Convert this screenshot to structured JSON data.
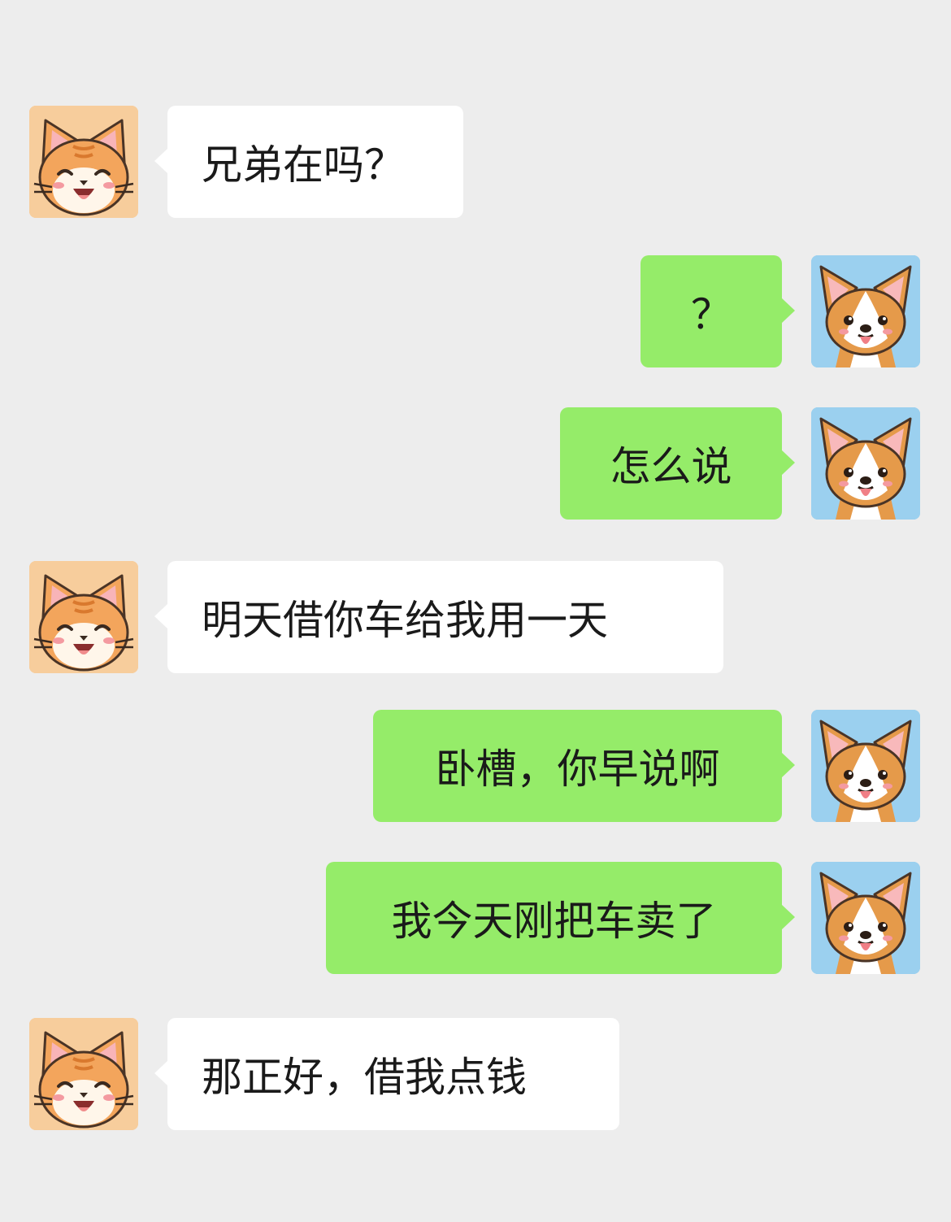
{
  "chat": {
    "messages": [
      {
        "side": "in",
        "sender": "cat",
        "text": "兄弟在吗？"
      },
      {
        "side": "out",
        "sender": "dog",
        "text": "？"
      },
      {
        "side": "out",
        "sender": "dog",
        "text": "怎么说"
      },
      {
        "side": "in",
        "sender": "cat",
        "text": "明天借你车给我用一天"
      },
      {
        "side": "out",
        "sender": "dog",
        "text": "卧槽，你早说啊"
      },
      {
        "side": "out",
        "sender": "dog",
        "text": "我今天刚把车卖了"
      },
      {
        "side": "in",
        "sender": "cat",
        "text": "那正好，借我点钱"
      }
    ]
  },
  "colors": {
    "background": "#ededed",
    "incoming_bubble": "#ffffff",
    "outgoing_bubble": "#95ec69",
    "cat_avatar_bg": "#f7cd9c",
    "dog_avatar_bg": "#9bd0ef"
  },
  "icons": {
    "cat_avatar": "cat-avatar-icon",
    "dog_avatar": "dog-avatar-icon"
  }
}
